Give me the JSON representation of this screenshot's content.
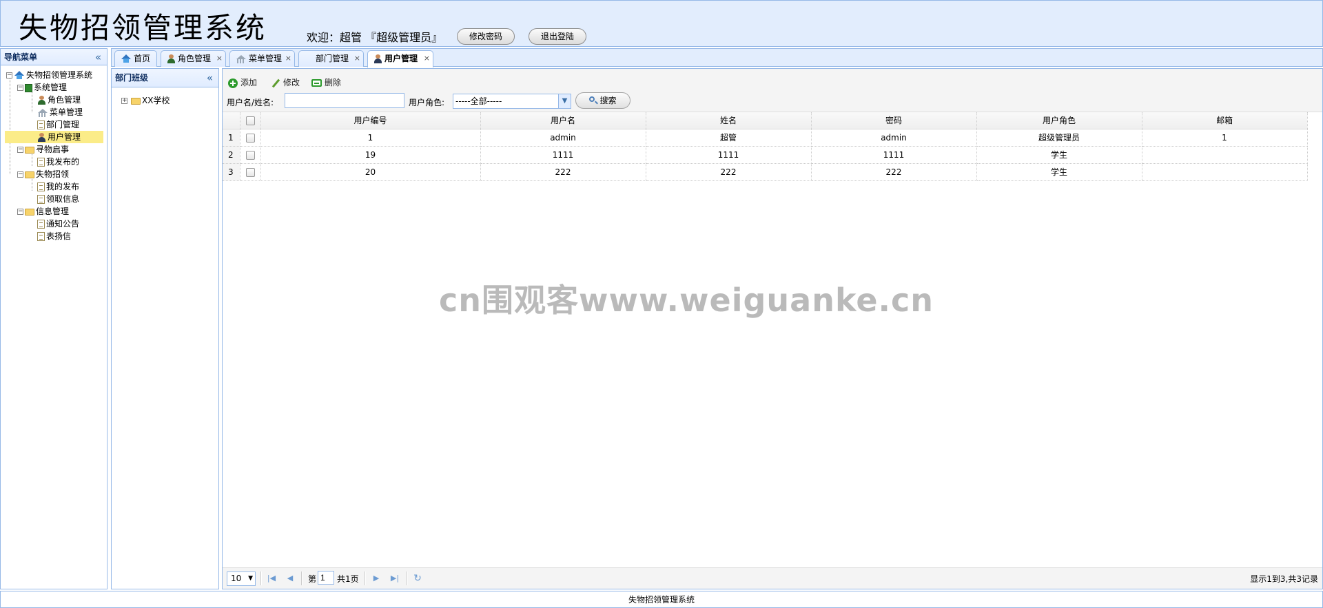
{
  "header": {
    "title": "失物招领管理系统",
    "welcome": "欢迎：超管 『超级管理员』",
    "change_password": "修改密码",
    "logout": "退出登陆"
  },
  "nav": {
    "title": "导航菜单",
    "collapse": "«",
    "root": "失物招领管理系统",
    "items": [
      {
        "label": "系统管理"
      },
      {
        "label": "角色管理"
      },
      {
        "label": "菜单管理"
      },
      {
        "label": "部门管理"
      },
      {
        "label": "用户管理"
      },
      {
        "label": "寻物启事"
      },
      {
        "label": "我发布的"
      },
      {
        "label": "失物招领"
      },
      {
        "label": "我的发布"
      },
      {
        "label": "领取信息"
      },
      {
        "label": "信息管理"
      },
      {
        "label": "通知公告"
      },
      {
        "label": "表扬信"
      }
    ]
  },
  "tabs": [
    {
      "label": "首页",
      "icon": "home-icon"
    },
    {
      "label": "角色管理",
      "icon": "user-icon",
      "close": "×"
    },
    {
      "label": "菜单管理",
      "icon": "menu-icon",
      "close": "×"
    },
    {
      "label": "部门管理",
      "icon": "none",
      "close": "×"
    },
    {
      "label": "用户管理",
      "icon": "user-icon",
      "close": "×",
      "active": true
    }
  ],
  "dept": {
    "title": "部门班级",
    "collapse": "«",
    "root": "XX学校"
  },
  "toolbar": {
    "add": "添加",
    "edit": "修改",
    "delete": "删除",
    "search_label": "用户名/姓名:",
    "search_value": "",
    "role_label": "用户角色:",
    "role_value": "-----全部-----",
    "search_button": "搜索"
  },
  "grid": {
    "columns": [
      "用户编号",
      "用户名",
      "姓名",
      "密码",
      "用户角色",
      "邮箱"
    ],
    "rows": [
      {
        "num": "1",
        "cells": [
          "1",
          "admin",
          "超管",
          "admin",
          "超级管理员",
          "1"
        ]
      },
      {
        "num": "2",
        "cells": [
          "19",
          "1111",
          "1111",
          "1111",
          "学生",
          ""
        ]
      },
      {
        "num": "3",
        "cells": [
          "20",
          "222",
          "222",
          "222",
          "学生",
          ""
        ]
      }
    ]
  },
  "pager": {
    "page_size": "10",
    "page_prefix": "第",
    "page": "1",
    "page_suffix": "共1页",
    "summary": "显示1到3,共3记录"
  },
  "footer": {
    "text": "失物招领管理系统"
  },
  "watermark": "cn围观客www.weiguanke.cn"
}
